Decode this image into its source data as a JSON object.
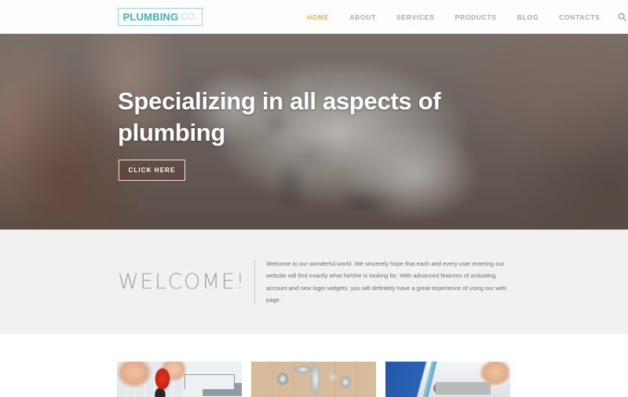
{
  "header": {
    "logo": {
      "main": "PLUMBING",
      "sub": "CO."
    },
    "nav": [
      {
        "label": "HOME",
        "active": true
      },
      {
        "label": "ABOUT",
        "active": false
      },
      {
        "label": "SERVICES",
        "active": false
      },
      {
        "label": "PRODUCTS",
        "active": false
      },
      {
        "label": "BLOG",
        "active": false
      },
      {
        "label": "CONTACTS",
        "active": false
      }
    ],
    "search_icon": "search-icon",
    "accent_color": "#dfb550",
    "logo_color": "#35b5bd"
  },
  "hero": {
    "title": "Specializing in all aspects of plumbing",
    "cta_label": "CLICK HERE",
    "image_alt": "blurred adjustable wrench pliers held in hand"
  },
  "welcome": {
    "title": "WELCOME!",
    "paragraph": "Welcome to our wonderful world. We sincerely hope that each and every user entering our website will find exactly what he/she is looking for. With advanced features of activating account and new login widgets, you will definitely have a great experience of using our web page.",
    "background_color": "#f1f1f1"
  },
  "cards": [
    {
      "alt": "hand pressing red valve handle on white tiled wall"
    },
    {
      "alt": "chrome faucet and pipe fittings on beige tile"
    },
    {
      "alt": "worker in blue shirt cutting grey pvc pipe"
    }
  ]
}
